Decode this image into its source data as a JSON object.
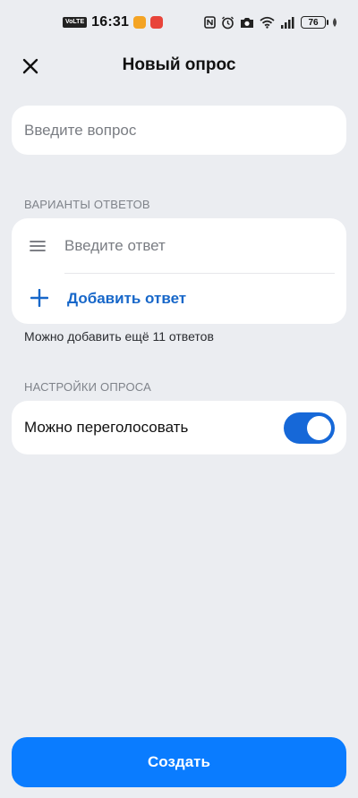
{
  "status_bar": {
    "volte": "VoLTE",
    "time": "16:31",
    "battery": "76"
  },
  "header": {
    "title": "Новый опрос"
  },
  "question": {
    "placeholder": "Введите вопрос"
  },
  "answers": {
    "section_title": "ВАРИАНТЫ ОТВЕТОВ",
    "items": [
      {
        "placeholder": "Введите ответ"
      }
    ],
    "add_label": "Добавить ответ",
    "hint": "Можно добавить ещё 11 ответов"
  },
  "settings": {
    "section_title": "НАСТРОЙКИ ОПРОСА",
    "revote_label": "Можно переголосовать",
    "revote_enabled": true
  },
  "footer": {
    "create_label": "Создать"
  },
  "colors": {
    "background": "#ebedf1",
    "accent": "#0a7cff",
    "link": "#1767c9",
    "toggle_on": "#1668d8"
  }
}
